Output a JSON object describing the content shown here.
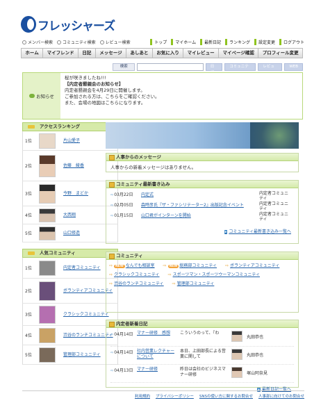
{
  "brand": {
    "logo_text": "フレッシャーズ"
  },
  "search_links": [
    "メンバー検索",
    "コミュニティ検索",
    "レビュー検索"
  ],
  "top_links": [
    "トップ",
    "マイホーム",
    "最新日記",
    "ランキング",
    "設定変更",
    "ログアウト"
  ],
  "gnav": [
    "ホーム",
    "マイフレンド",
    "日記",
    "メッセージ",
    "あしあと",
    "お気に入り",
    "マイレビュー",
    "マイページ確認",
    "プロフィール変更"
  ],
  "searchbar": {
    "label": "検索",
    "tags": [
      "日記",
      "コミュニティ",
      "レビュー",
      "WEB"
    ]
  },
  "notice": {
    "label": "お知らせ",
    "lines": [
      "桜が咲きましたね!!!",
      "【内定者懇親会のお知らせ】",
      "内定者懇親会を4月29日に開催します。",
      "ご参加される方は、こちらをご確認ください。",
      "また、会場の地図はこちらになります。"
    ]
  },
  "access_ranking": {
    "title": "アクセスランキング",
    "items": [
      {
        "rank": "1位",
        "name": "片山愛子"
      },
      {
        "rank": "2位",
        "name": "佐藤　綾香"
      },
      {
        "rank": "3位",
        "name": "今野　まどか"
      },
      {
        "rank": "4位",
        "name": "大西翔"
      },
      {
        "rank": "5位",
        "name": "山口修造"
      }
    ]
  },
  "popular_community": {
    "title": "人気コミュニティ",
    "items": [
      {
        "rank": "1位",
        "name": "内定者コミュニティ"
      },
      {
        "rank": "2位",
        "name": "ボランティアコミュニティ"
      },
      {
        "rank": "3位",
        "name": "クラシックコミュニティ"
      },
      {
        "rank": "4位",
        "name": "渋谷のランチコミュニティ"
      },
      {
        "rank": "5位",
        "name": "管理部コミュニティ"
      }
    ]
  },
  "hr_message": {
    "title": "人事からのメッセージ",
    "body": "人事からの新着メッセージはありません。"
  },
  "community_posts": {
    "title": "コミュニティ最新書き込み",
    "rows": [
      {
        "date": "03月22日",
        "title": "内定式",
        "community": "内定者コミュニティ"
      },
      {
        "date": "02月05日",
        "title": "森時彦氏『ザ・ファシリテーター2』出版記念イベント",
        "community": "内定者コミュニティ"
      },
      {
        "date": "01月15日",
        "title": "山口君がインターンを開始",
        "community": "内定者コミュニティ"
      }
    ],
    "more": "コミュニティ最新書き込み一覧へ"
  },
  "community": {
    "title": "コミュニティ",
    "new_badge": "NEW",
    "links": [
      "なんでも相談室",
      "総務部コミュニティ",
      "ボランティアコミュニティ",
      "クラシックコミュニティ",
      "スポーツマン・スポーツウーマンコミュニティ",
      "渋谷のランチコミュニティ",
      "管理部コミュニティ"
    ]
  },
  "new_diary": {
    "title": "内定者新着日記",
    "rows": [
      {
        "date": "04月14日",
        "title": "マナー研修　感想",
        "excerpt": "こういうのって、『わ",
        "author": "丸田恭也"
      },
      {
        "date": "04月14日",
        "title": "社内営業レクチャーについて",
        "excerpt": "本日、上田部長による営業に関して",
        "author": "丸田恭也"
      },
      {
        "date": "04月13日",
        "title": "マナー研修",
        "excerpt": "昨日は会社のビジネスマナー研修",
        "author": "塚山阿奈見"
      }
    ],
    "more": "最新日記一覧へ"
  },
  "footer": [
    "利用規約",
    "プライバシーポリシー",
    "SNSの使い方に関するお問合せ",
    "人事部に向けてのお問合せ"
  ]
}
